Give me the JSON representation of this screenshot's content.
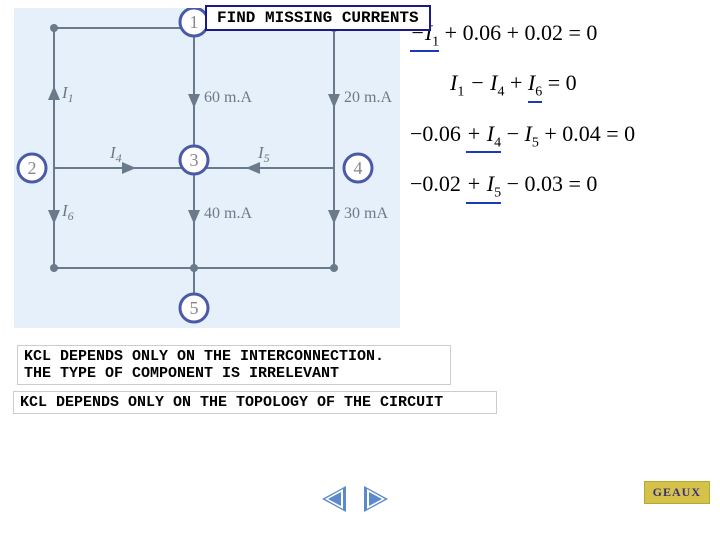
{
  "title": "FIND MISSING CURRENTS",
  "nodes": {
    "1": "1",
    "2": "2",
    "3": "3",
    "4": "4",
    "5": "5"
  },
  "branch_labels": {
    "I1": "I",
    "I1_sub": "1",
    "I4": "I",
    "I4_sub": "4",
    "I5": "I",
    "I5_sub": "5",
    "I6": "I",
    "I6_sub": "6",
    "c60": "60 m.A",
    "c20": "20 m.A",
    "c40": "40 m.A",
    "c30": "30 mA"
  },
  "equations": {
    "eq1_a": "−I",
    "eq1_a_sub": "1",
    "eq1_b": " + 0.06 + 0.02 = 0",
    "eq2_a": "I",
    "eq2_a_sub": "1",
    "eq2_b": " − I",
    "eq2_b_sub": "4",
    "eq2_c": " + ",
    "eq2_d": "I",
    "eq2_d_sub": "6",
    "eq2_e": " = 0",
    "eq3_a": "−0.06 ",
    "eq3_b": "+ I",
    "eq3_b_sub": "4",
    "eq3_c": " − ",
    "eq3_d": "I",
    "eq3_d_sub": "5",
    "eq3_e": " + 0.04 = 0",
    "eq4_a": "−0.02 ",
    "eq4_b": "+ I",
    "eq4_b_sub": "5",
    "eq4_c": " − 0.03 = 0"
  },
  "notes": {
    "n1_line1": "KCL DEPENDS ONLY ON THE INTERCONNECTION.",
    "n1_line2": "THE TYPE OF COMPONENT IS IRRELEVANT",
    "n2": "KCL DEPENDS ONLY ON THE TOPOLOGY OF THE CIRCUIT"
  },
  "footer": {
    "logo": "GEAUX"
  }
}
